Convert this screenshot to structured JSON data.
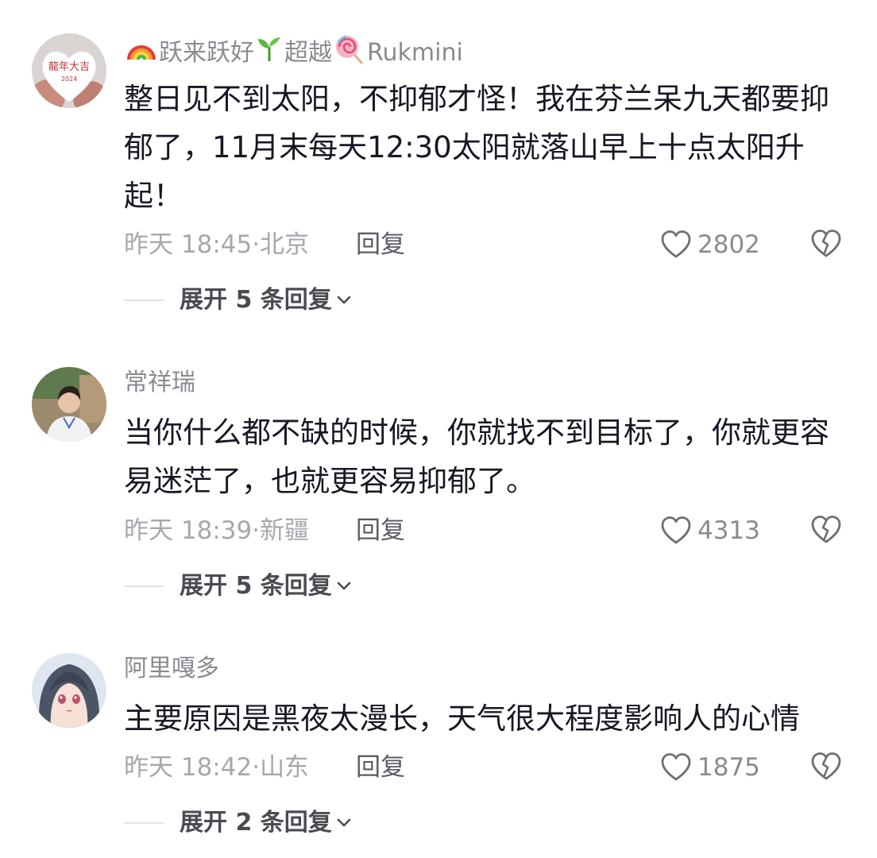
{
  "comments": [
    {
      "username_parts": [
        "跃来跃好",
        "超越",
        "Rukmini"
      ],
      "username_icons": [
        "rainbow-icon",
        "seedling-icon",
        "lollipop-icon"
      ],
      "content": "整日见不到太阳，不抑郁才怪！我在芬兰呆九天都要抑郁了，11月末每天12:30太阳就落山早上十点太阳升起！",
      "time": "昨天 18:45",
      "location": "北京",
      "reply_label": "回复",
      "likes": "2802",
      "expand_label": "展开 5 条回复",
      "avatar_text": "龍年大吉"
    },
    {
      "username": "常祥瑞",
      "content": "当你什么都不缺的时候，你就找不到目标了，你就更容易迷茫了，也就更容易抑郁了。",
      "time": "昨天 18:39",
      "location": "新疆",
      "reply_label": "回复",
      "likes": "4313",
      "expand_label": "展开 5 条回复"
    },
    {
      "username": "阿里嘎多",
      "content": "主要原因是黑夜太漫长，天气很大程度影响人的心情",
      "time": "昨天 18:42",
      "location": "山东",
      "reply_label": "回复",
      "likes": "1875",
      "expand_label": "展开 2 条回复"
    }
  ],
  "meta_separator": "·",
  "icons": {
    "like": "heart-outline-icon",
    "dislike": "broken-heart-icon",
    "expand": "chevron-down-icon"
  },
  "colors": {
    "text_primary": "#161823",
    "text_secondary": "#8a8b91",
    "text_meta": "#a7a8ad"
  }
}
